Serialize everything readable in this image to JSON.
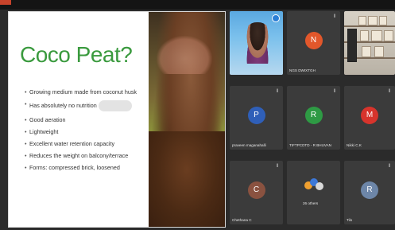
{
  "slide": {
    "title": "Coco Peat?",
    "bullets": [
      "Growing medium made from coconut husk",
      "Has absolutely no nutrition",
      "Good aeration",
      "Lightweight",
      "Excellent water retention capacity",
      "Reduces the weight on balcony/terrace",
      "Forms: compressed brick, loosened"
    ]
  },
  "participants": [
    {
      "name": "",
      "type": "video-self"
    },
    {
      "name": "NGS DWIXTGH",
      "initial": "N",
      "color": "#e2572b"
    },
    {
      "name": "",
      "type": "video-office"
    },
    {
      "name": "praveen maganahalli",
      "initial": "P",
      "color": "#2f5fb8"
    },
    {
      "name": "TIFTPCDTD - R BHUVAN",
      "initial": "R",
      "color": "#2e9a44"
    },
    {
      "name": "Nikki C.K",
      "initial": "M",
      "color": "#d7342c"
    },
    {
      "name": "Chethana C",
      "initial": "C",
      "color": "#8a5240"
    },
    {
      "name": "26 others",
      "initial": "",
      "color": "#3b3b3b",
      "type": "group"
    },
    {
      "name": "Tilo",
      "initial": "R",
      "color": "#6d86a8"
    }
  ],
  "icons": {
    "mic": "mic-off-icon",
    "group": "group-avatars-icon"
  }
}
